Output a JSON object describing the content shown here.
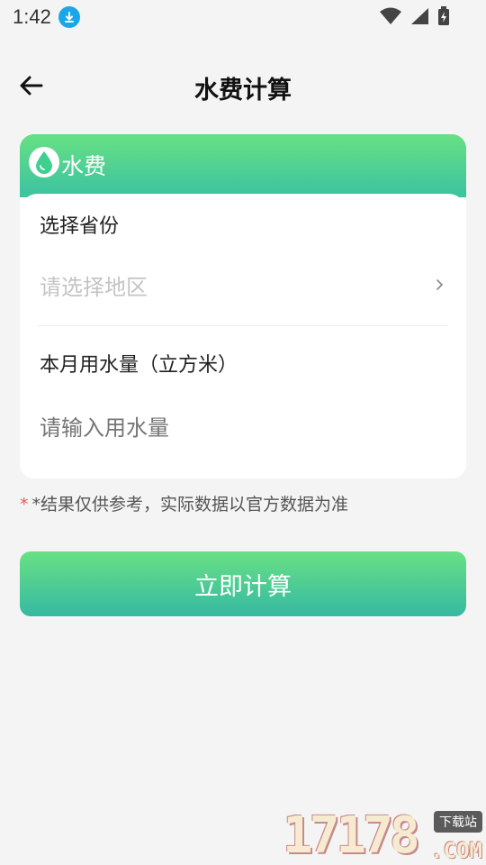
{
  "status_bar": {
    "time": "1:42",
    "icons": [
      "download-icon",
      "wifi-icon",
      "signal-icon",
      "battery-icon"
    ]
  },
  "app_bar": {
    "back_icon": "arrow-left-icon",
    "title": "水费计算"
  },
  "card": {
    "header_icon": "water-drop-icon",
    "header_label": "水费",
    "province": {
      "label": "选择省份",
      "placeholder": "请选择地区",
      "chevron_icon": "chevron-right-icon"
    },
    "usage": {
      "label": "本月用水量（立方米）",
      "placeholder": "请输入用水量"
    }
  },
  "note": {
    "star": "*",
    "text": "*结果仅供参考，实际数据以官方数据为准"
  },
  "calc_button": {
    "label": "立即计算"
  },
  "watermark": {
    "number": "17178",
    "tag": "下载站",
    "suffix": ".COM"
  },
  "colors": {
    "accent_top": "#67e183",
    "accent_bottom": "#36b9a2",
    "background": "#f4f4f4",
    "placeholder": "#c4c4c4",
    "note_star": "#e85a5a"
  }
}
